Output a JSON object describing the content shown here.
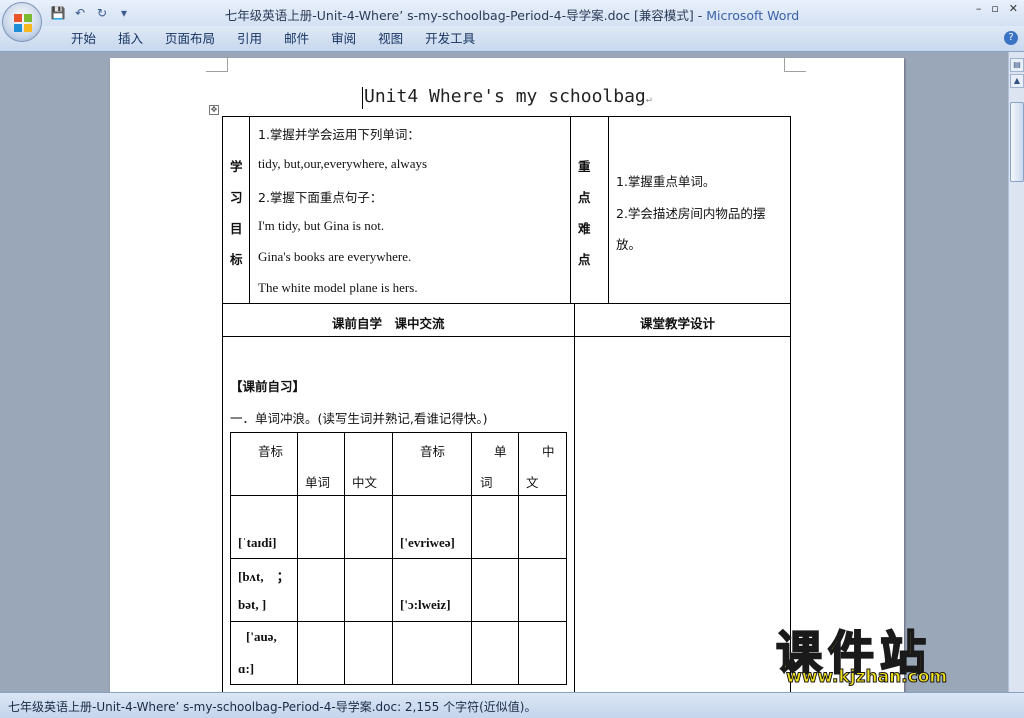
{
  "window": {
    "title_doc": "七年级英语上册-Unit-4-Where’ s-my-schoolbag-Period-4-导学案.doc [兼容模式] - ",
    "title_app": "Microsoft Word",
    "controls": [
      "–",
      "▫",
      "✕"
    ]
  },
  "qat": {
    "save": "💾",
    "undo": "↶",
    "redo": "↻",
    "more": "▾"
  },
  "ribbon": {
    "tabs": [
      "开始",
      "插入",
      "页面布局",
      "引用",
      "邮件",
      "审阅",
      "视图",
      "开发工具"
    ],
    "help": "?"
  },
  "doc": {
    "title": "Unit4 Where's my schoolbag",
    "mark": "↵",
    "goals": {
      "label": [
        "学",
        "习",
        "目",
        "标"
      ],
      "lines": [
        "1.掌握并学会运用下列单词：",
        "tidy, but,our,everywhere, always",
        "2.掌握下面重点句子：",
        "I'm tidy, but Gina is not.",
        "Gina's books are everywhere.",
        "The white model plane is hers."
      ]
    },
    "key_points": {
      "label": [
        "重",
        "点",
        "难",
        "点"
      ],
      "lines": [
        "1.掌握重点单词。",
        "2.学会描述房间内物品的摆",
        "放。"
      ]
    },
    "section_left": "课前自学　课中交流",
    "section_right": "课堂教学设计",
    "preview_heading": "【课前自习】",
    "exercise": "一．单词冲浪。(读写生词并熟记,看谁记得快。)",
    "vocab_table": {
      "headers": [
        "音标",
        "单词",
        "中文",
        "音标",
        "单",
        "词",
        "中",
        "文"
      ],
      "rows": [
        {
          "ph1": "[ˈtaɪdi]",
          "ph2": "['evriweə]"
        },
        {
          "ph1a": "[bʌt,　；",
          "ph1b": "bət, ]",
          "ph2": "['ɔ:lweiz]"
        },
        {
          "ph1a": "['auə,",
          "ph1b": "ɑ:]"
        }
      ]
    }
  },
  "status": {
    "text": "七年级英语上册-Unit-4-Where’ s-my-schoolbag-Period-4-导学案.doc: 2,155 个字符(近似值)。"
  },
  "watermark": {
    "cn": "课件站",
    "url": "www.kjzhan.com"
  },
  "colors": {
    "ribbon": "#c8d8ee",
    "accent": "#3a62a8",
    "watermark": "#f3e21a"
  }
}
